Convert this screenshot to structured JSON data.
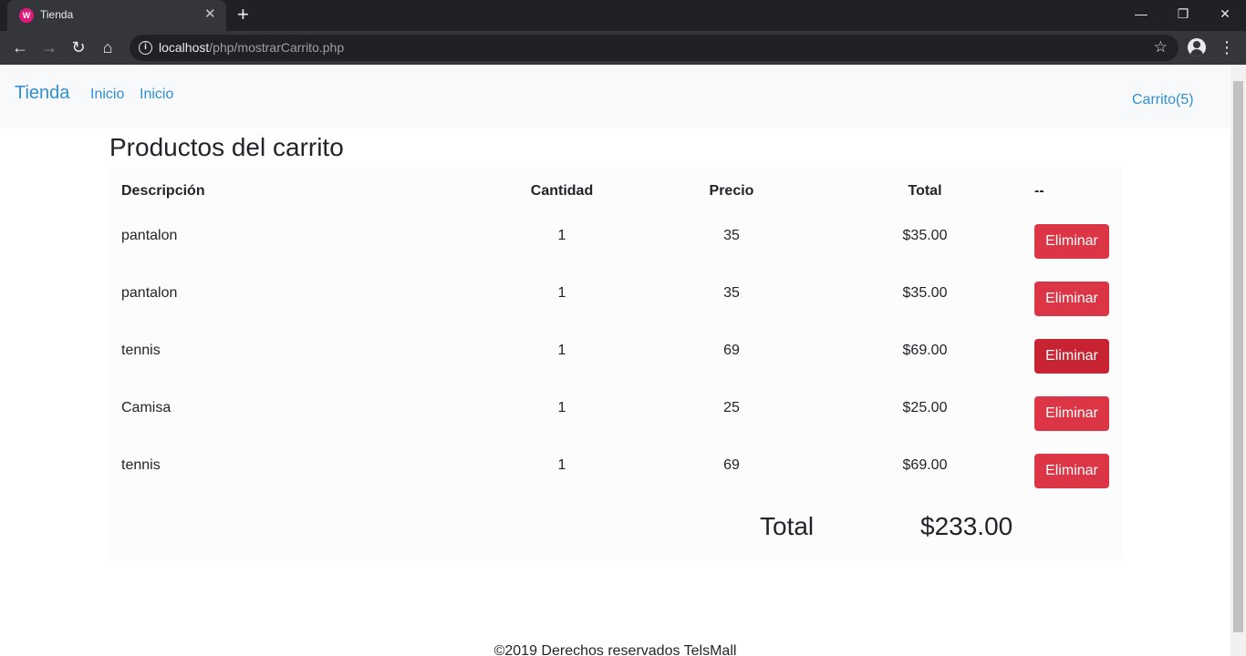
{
  "browser": {
    "tab_title": "Tienda",
    "tab_favicon": "tienda-favicon",
    "url_host": "localhost",
    "url_path": "/php/mostrarCarrito.php"
  },
  "navbar": {
    "brand": "Tienda",
    "links": [
      "Inicio",
      "Inicio"
    ],
    "cart": "Carrito(5)"
  },
  "page": {
    "title": "Productos del carrito"
  },
  "table": {
    "headers": {
      "description": "Descripción",
      "quantity": "Cantidad",
      "price": "Precio",
      "total": "Total",
      "actions": "--"
    },
    "rows": [
      {
        "description": "pantalon",
        "quantity": "1",
        "price": "35",
        "total": "$35.00",
        "action": "Eliminar"
      },
      {
        "description": "pantalon",
        "quantity": "1",
        "price": "35",
        "total": "$35.00",
        "action": "Eliminar"
      },
      {
        "description": "tennis",
        "quantity": "1",
        "price": "69",
        "total": "$69.00",
        "action": "Eliminar"
      },
      {
        "description": "Camisa",
        "quantity": "1",
        "price": "25",
        "total": "$25.00",
        "action": "Eliminar"
      },
      {
        "description": "tennis",
        "quantity": "1",
        "price": "69",
        "total": "$69.00",
        "action": "Eliminar"
      }
    ],
    "grand_total_label": "Total",
    "grand_total_value": "$233.00"
  },
  "footer": {
    "text": "©2019 Derechos reservados TelsMall"
  },
  "colors": {
    "link": "#2f8fd6",
    "danger": "#dc3545",
    "danger_hover": "#c82333"
  }
}
